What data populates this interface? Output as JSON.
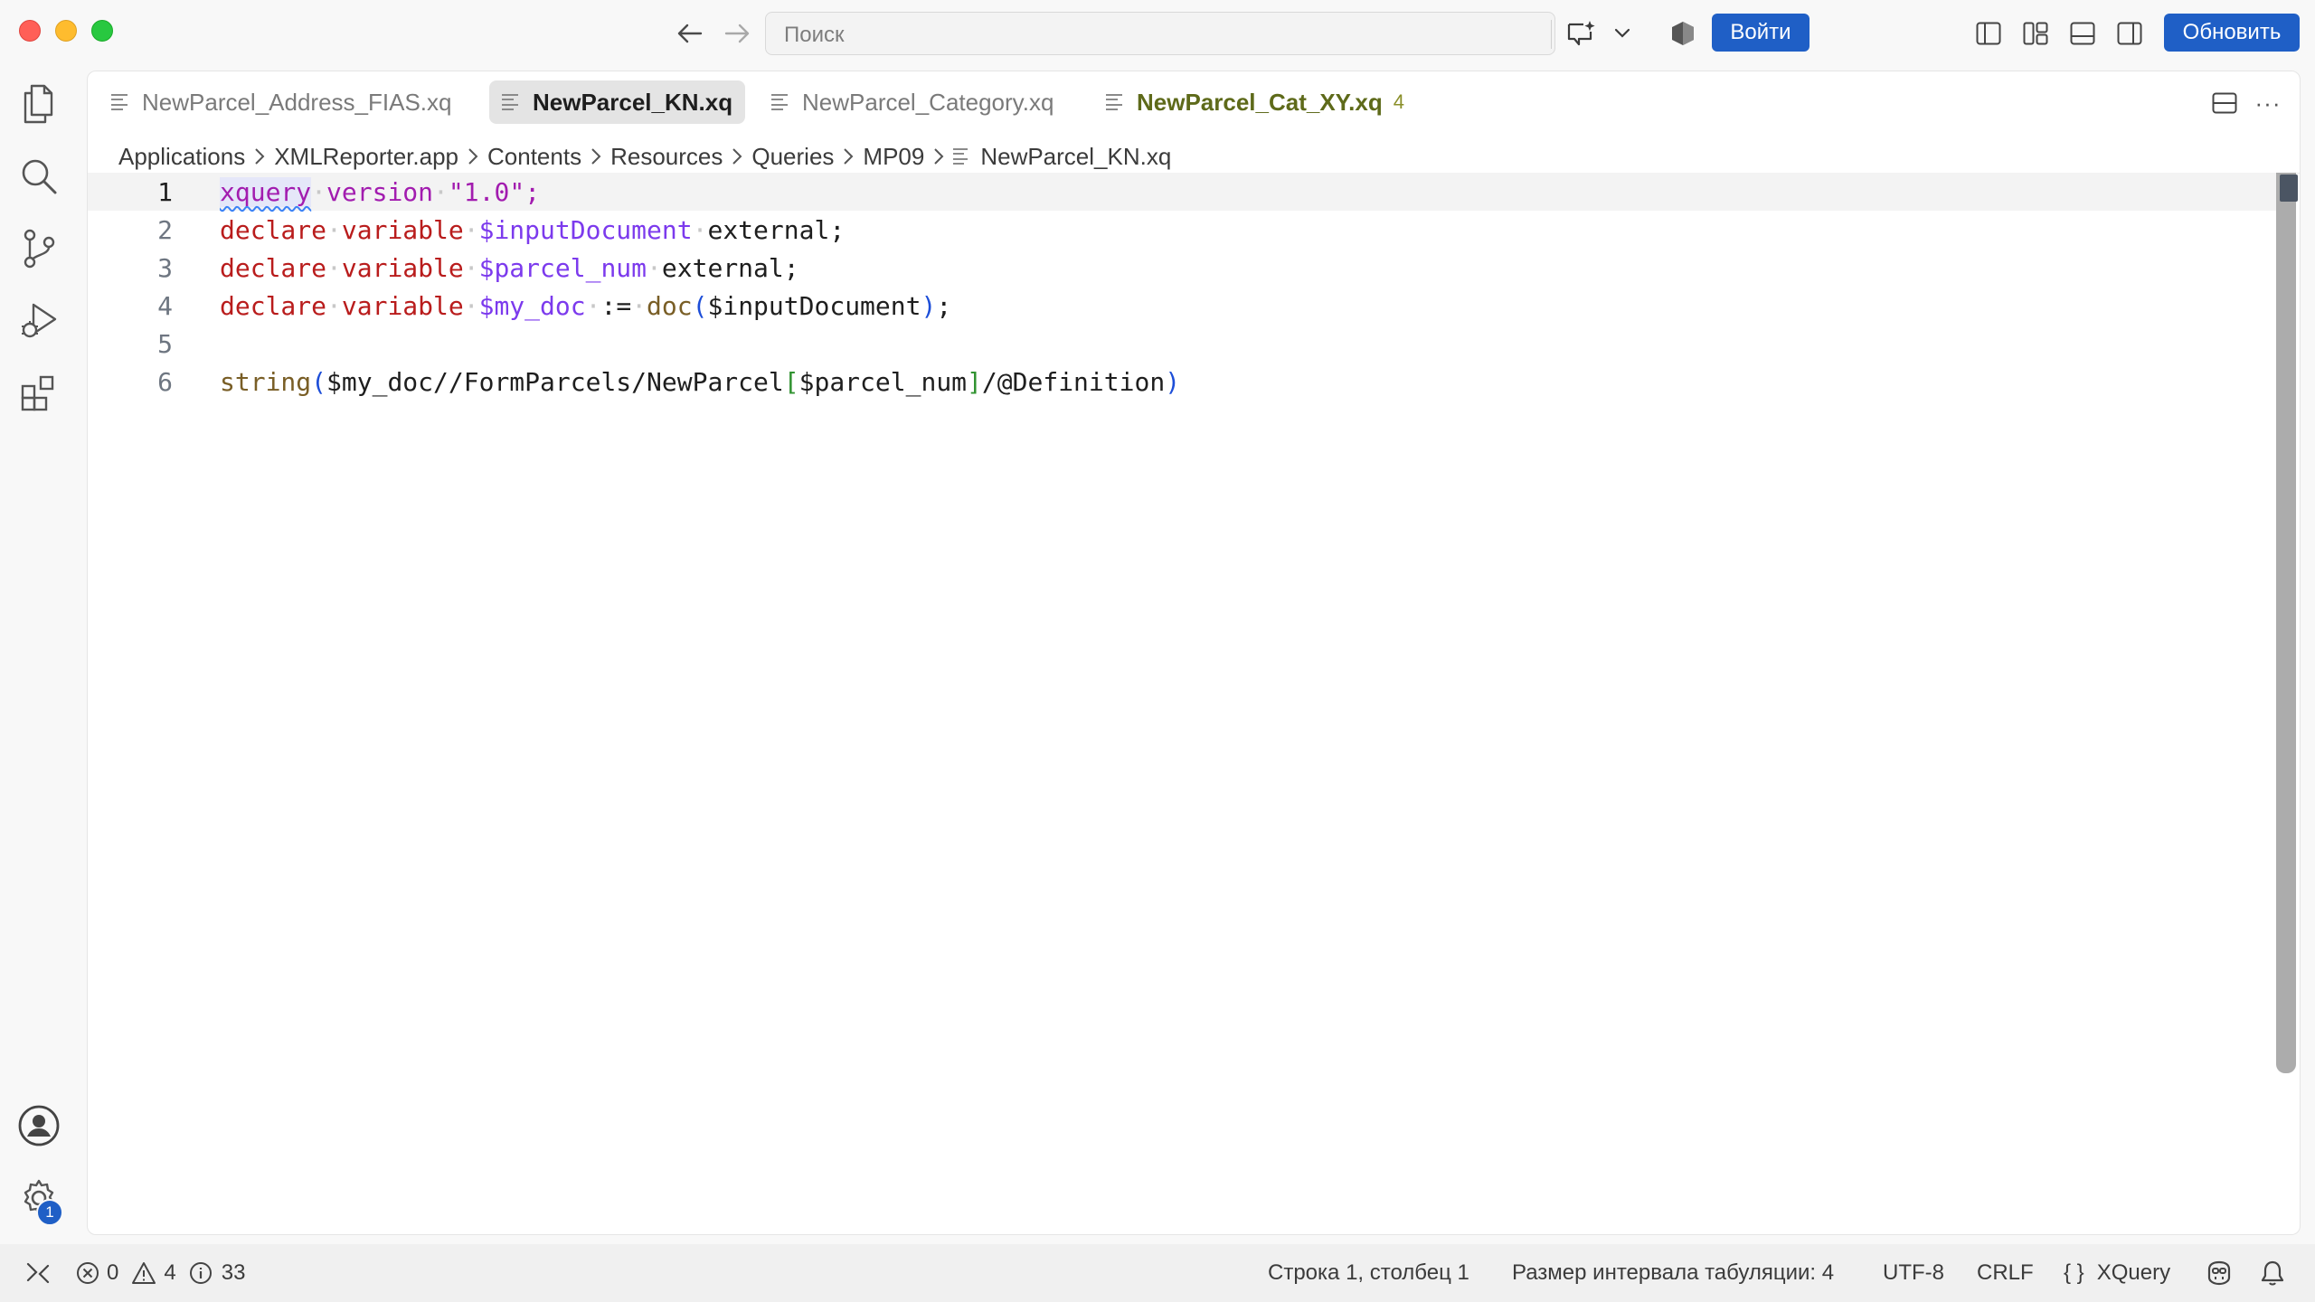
{
  "titlebar": {
    "search_placeholder": "Поиск",
    "login_label": "Войти",
    "update_label": "Обновить"
  },
  "tabs": [
    {
      "label": "NewParcel_Address_FIAS.xq",
      "state": "inactive"
    },
    {
      "label": "NewParcel_KN.xq",
      "state": "active"
    },
    {
      "label": "NewParcel_Category.xq",
      "state": "inactive"
    },
    {
      "label": "NewParcel_Cat_XY.xq",
      "state": "warning",
      "count": "4"
    }
  ],
  "breadcrumb": [
    "Applications",
    "XMLReporter.app",
    "Contents",
    "Resources",
    "Queries",
    "MP09",
    "NewParcel_KN.xq"
  ],
  "editor": {
    "line_numbers": [
      "1",
      "2",
      "3",
      "4",
      "5",
      "6"
    ]
  },
  "activity": {
    "settings_badge": "1"
  },
  "statusbar": {
    "errors": "0",
    "warnings": "4",
    "info": "33",
    "cursor_position": "Строка 1, столбец 1",
    "tab_size": "Размер интервала табуляции: 4",
    "encoding": "UTF-8",
    "eol": "CRLF",
    "language": "XQuery",
    "language_braces": "{ }"
  },
  "colors": {
    "accent": "#1f5fc6",
    "keyword": "#b91c1c",
    "variable": "#7c3aed",
    "string": "#a21caf"
  }
}
